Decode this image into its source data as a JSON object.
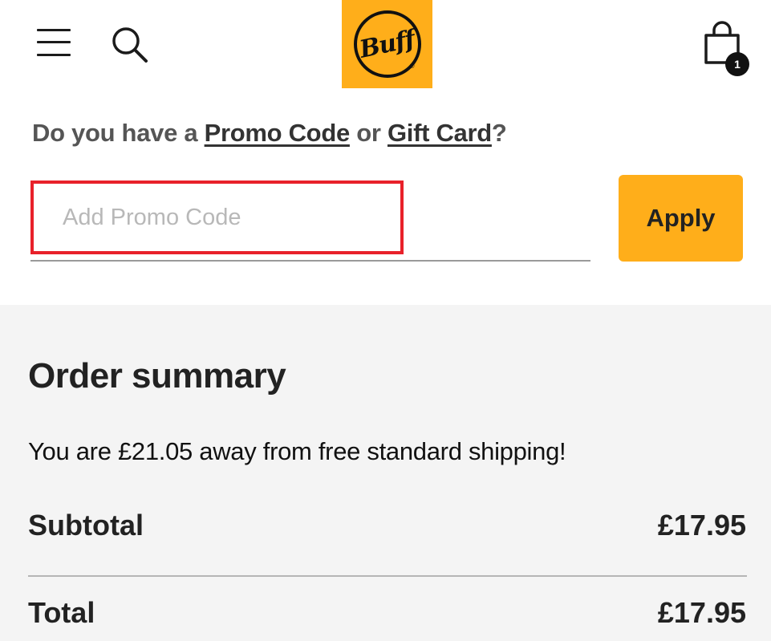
{
  "header": {
    "menu_icon": "hamburger-menu-icon",
    "search_icon": "search-icon",
    "logo_text": "Buff",
    "logo_registered": "®",
    "cart_icon": "shopping-bag-icon",
    "cart_count": "1",
    "brand_color": "#ffae1a"
  },
  "promo": {
    "question_prefix": "Do you have a",
    "promo_link": "Promo Code",
    "connector": "or",
    "gift_link": "Gift Card",
    "question_suffix": "?",
    "input_placeholder": "Add Promo Code",
    "input_value": "",
    "apply_label": "Apply",
    "highlight_color": "#e8212a"
  },
  "summary": {
    "title": "Order summary",
    "shipping_message": "You are £21.05 away from free standard shipping!",
    "subtotal_label": "Subtotal",
    "subtotal_value": "£17.95",
    "total_label": "Total",
    "total_value": "£17.95"
  }
}
